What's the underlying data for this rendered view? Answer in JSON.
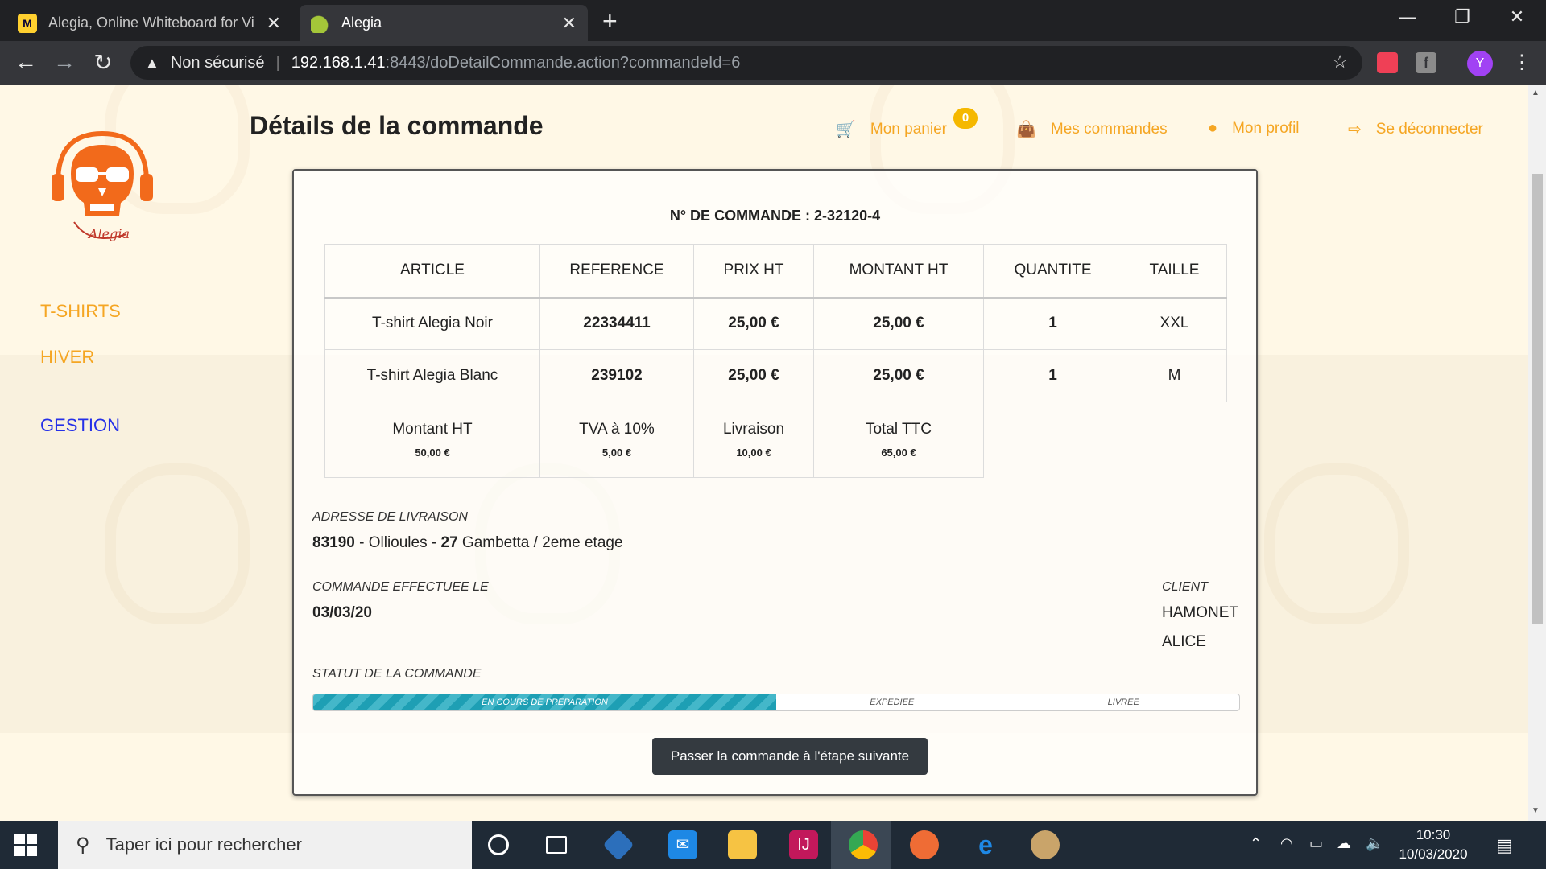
{
  "browser": {
    "tabs": [
      {
        "title": "Alegia, Online Whiteboard for Vi",
        "favicon": "miro-icon",
        "favicon_text": "M"
      },
      {
        "title": "Alegia",
        "favicon": "leaf-icon"
      }
    ],
    "new_tab_glyph": "+",
    "close_glyph": "✕",
    "window_controls": {
      "minimize": "—",
      "maximize": "❐",
      "close": "✕"
    },
    "nav": {
      "back": "←",
      "forward": "→",
      "reload": "↻"
    },
    "address": {
      "warning_glyph": "▲",
      "security_label": "Non sécurisé",
      "host": "192.168.1.41",
      "path": ":8443/doDetailCommande.action?commandeId=6"
    },
    "star_glyph": "☆",
    "ext_fb_text": "f",
    "profile_initial": "Y",
    "menu_glyph": "⋮"
  },
  "header": {
    "page_title": "Détails de la commande",
    "nav": [
      {
        "label": "Mon panier",
        "icon": "cart-icon",
        "glyph": "🛒"
      },
      {
        "label": "Mes commandes",
        "icon": "bag-icon",
        "glyph": "👜"
      },
      {
        "label": "Mon profil",
        "icon": "user-icon",
        "glyph": "●"
      },
      {
        "label": "Se déconnecter",
        "icon": "logout-icon",
        "glyph": "⇨"
      }
    ],
    "cart_count": "0"
  },
  "sidebar": {
    "items": [
      {
        "label": "T-SHIRTS"
      },
      {
        "label": "HIVER"
      },
      {
        "label": "GESTION"
      }
    ]
  },
  "order": {
    "number_label": "N° DE COMMANDE : 2-32120-4",
    "columns": [
      "ARTICLE",
      "REFERENCE",
      "PRIX HT",
      "MONTANT HT",
      "QUANTITE",
      "TAILLE"
    ],
    "rows": [
      [
        "T-shirt Alegia Noir",
        "22334411",
        "25,00 €",
        "25,00 €",
        "1",
        "XXL"
      ],
      [
        "T-shirt Alegia Blanc",
        "239102",
        "25,00 €",
        "25,00 €",
        "1",
        "M"
      ]
    ],
    "totals": [
      {
        "label": "Montant HT",
        "value": "50,00 €"
      },
      {
        "label": "TVA à 10%",
        "value": "5,00 €"
      },
      {
        "label": "Livraison",
        "value": "10,00 €"
      },
      {
        "label": "Total TTC",
        "value": "65,00 €"
      }
    ],
    "delivery_label": "ADRESSE DE LIVRAISON",
    "delivery_postcode": "83190",
    "delivery_sep1": " - ",
    "delivery_city": "Ollioules",
    "delivery_sep2": " - ",
    "delivery_number": "27",
    "delivery_street": " Gambetta / 2eme etage",
    "date_label": "COMMANDE EFFECTUEE LE",
    "date_value": "03/03/20",
    "client_label": "CLIENT",
    "client_last": "HAMONET",
    "client_first": "ALICE",
    "status_label": "STATUT DE LA COMMANDE",
    "status_steps": [
      "EN COURS DE PREPARATION",
      "EXPEDIEE",
      "LIVREE"
    ],
    "status_progress_fraction": 0.5,
    "next_step_button": "Passer la commande à l'étape suivante"
  },
  "taskbar": {
    "search_placeholder": "Taper ici pour rechercher",
    "search_glyph": "⚲",
    "time": "10:30",
    "date": "10/03/2020"
  },
  "colors": {
    "accent_orange": "#f5a623",
    "link_blue": "#2530e8",
    "progress_teal": "#1e9fb4",
    "button_dark": "#343a40"
  }
}
